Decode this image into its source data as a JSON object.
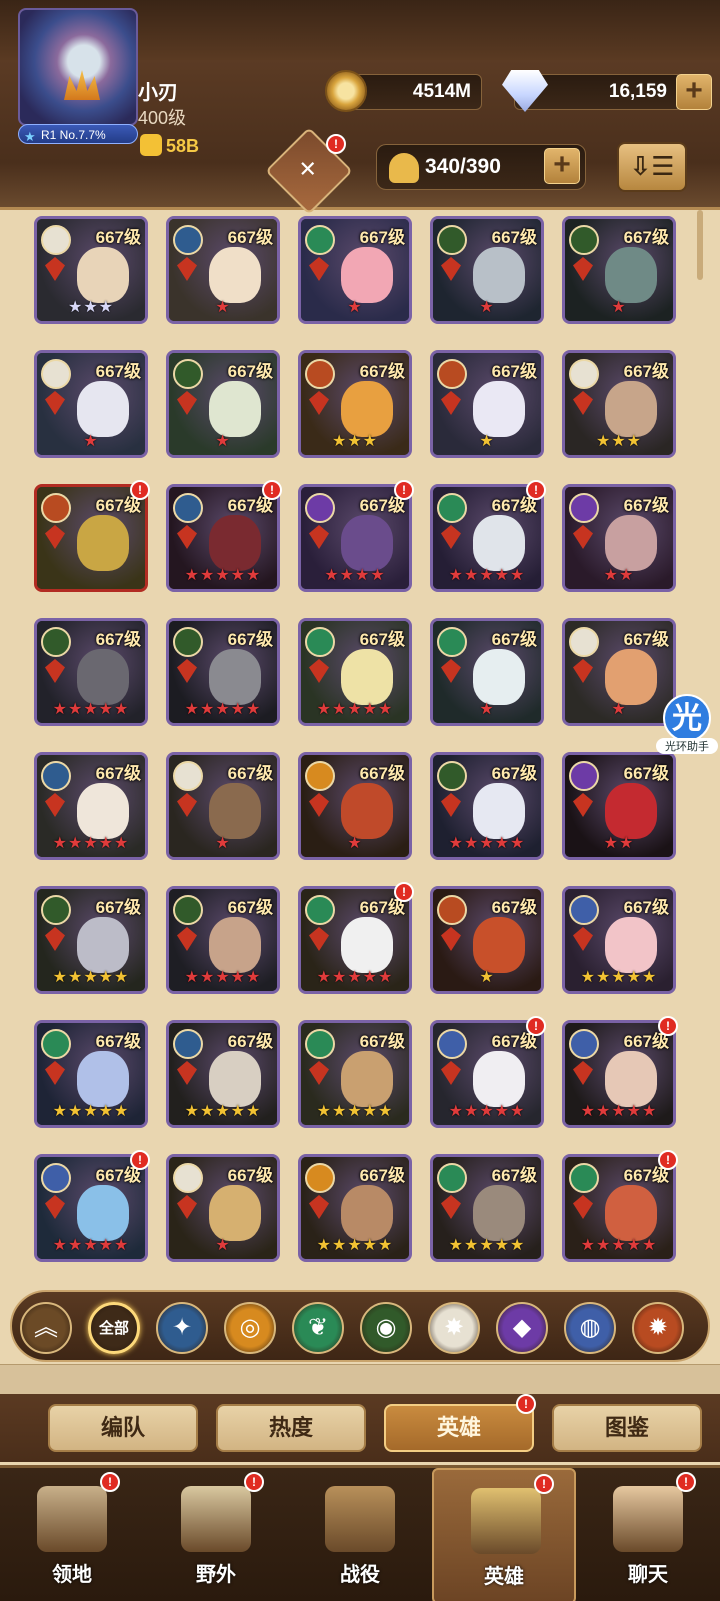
{
  "player": {
    "name": "小刃",
    "level": "400级",
    "power": "58B",
    "rank": "R1 No.7.7%"
  },
  "currencies": {
    "gold": "4514M",
    "gems": "16,159"
  },
  "hero_capacity": "340/390",
  "plus_symbol": "+",
  "sort_symbol": "⇩☰",
  "assistant_label": "光环助手",
  "assistant_glyph": "光",
  "filters": [
    {
      "name": "collapse",
      "glyph": "︽",
      "color": "#6b4a26"
    },
    {
      "name": "all",
      "label": "全部",
      "color": "#3e2a18"
    },
    {
      "name": "lightbearer",
      "glyph": "✦",
      "color": "#2f5c8f"
    },
    {
      "name": "mauler",
      "glyph": "◎",
      "color": "#d78a1f"
    },
    {
      "name": "wilder",
      "glyph": "❦",
      "color": "#2a8a56"
    },
    {
      "name": "graveborn",
      "glyph": "◉",
      "color": "#315a2a"
    },
    {
      "name": "celestial",
      "glyph": "✸",
      "color": "#e7e1d2"
    },
    {
      "name": "hypogean",
      "glyph": "◆",
      "color": "#6d3ba6"
    },
    {
      "name": "dimensional",
      "glyph": "◍",
      "color": "#3f5fa8"
    },
    {
      "name": "other",
      "glyph": "✹",
      "color": "#b84b21"
    }
  ],
  "subtabs": [
    {
      "label": "编队",
      "badge": false
    },
    {
      "label": "热度",
      "badge": false
    },
    {
      "label": "英雄",
      "badge": true,
      "active": true
    },
    {
      "label": "图鉴",
      "badge": false
    }
  ],
  "bottom_nav": [
    {
      "label": "领地",
      "badge": true
    },
    {
      "label": "野外",
      "badge": true
    },
    {
      "label": "战役",
      "badge": false
    },
    {
      "label": "英雄",
      "badge": true,
      "active": true
    },
    {
      "label": "聊天",
      "badge": true
    }
  ],
  "heroes": [
    {
      "level": "667级",
      "stars": "★★★",
      "star_color": "#d8d8f8",
      "faction_color": "#e7e1d2",
      "bg": "#2a2a30",
      "face": "#e8d4b8",
      "badge": false
    },
    {
      "level": "667级",
      "stars": "★",
      "star_color": "#e03b3b",
      "faction_color": "#2f5c8f",
      "bg": "#3a332b",
      "face": "#f0dfc8",
      "badge": false
    },
    {
      "level": "667级",
      "stars": "★",
      "star_color": "#e03b3b",
      "faction_color": "#2a8a56",
      "bg": "#2a2b4a",
      "face": "#f2a7b4",
      "badge": false
    },
    {
      "level": "667级",
      "stars": "★",
      "star_color": "#e03b3b",
      "faction_color": "#315a2a",
      "bg": "#1e2530",
      "face": "#b8c0c8",
      "badge": false
    },
    {
      "level": "667级",
      "stars": "★",
      "star_color": "#e03b3b",
      "faction_color": "#315a2a",
      "bg": "#1c2222",
      "face": "#6f8a86",
      "badge": false
    },
    {
      "level": "667级",
      "stars": "★",
      "star_color": "#e03b3b",
      "faction_color": "#e7e1d2",
      "bg": "#283040",
      "face": "#e6e6f0",
      "badge": false
    },
    {
      "level": "667级",
      "stars": "★",
      "star_color": "#e03b3b",
      "faction_color": "#315a2a",
      "bg": "#2a3a2a",
      "face": "#dfe6d0",
      "badge": false
    },
    {
      "level": "667级",
      "stars": "★★★",
      "star_color": "#f2c233",
      "faction_color": "#b84b21",
      "bg": "#3a2a18",
      "face": "#e8a040",
      "badge": false
    },
    {
      "level": "667级",
      "stars": "★",
      "star_color": "#f2c233",
      "faction_color": "#b84b21",
      "bg": "#2a2a3a",
      "face": "#eae8f4",
      "badge": false
    },
    {
      "level": "667级",
      "stars": "★★★",
      "star_color": "#f2c233",
      "faction_color": "#e7e1d2",
      "bg": "#2a2624",
      "face": "#c7a58a",
      "badge": false
    },
    {
      "level": "667级",
      "stars": "",
      "star_color": "#e03b3b",
      "faction_color": "#b84b21",
      "bg": "#3a3418",
      "face": "#c9a644",
      "badge": true,
      "border": "#b22c22"
    },
    {
      "level": "667级",
      "stars": "★★★★★",
      "star_color": "#e03b3b",
      "faction_color": "#2f5c8f",
      "bg": "#241620",
      "face": "#7a2a30",
      "badge": true
    },
    {
      "level": "667级",
      "stars": "★★★★",
      "star_color": "#e03b3b",
      "faction_color": "#6d3ba6",
      "bg": "#2a1f3a",
      "face": "#6a4c8c",
      "badge": true
    },
    {
      "level": "667级",
      "stars": "★★★★★",
      "star_color": "#e03b3b",
      "faction_color": "#2a8a56",
      "bg": "#251e35",
      "face": "#e0e4ea",
      "badge": true
    },
    {
      "level": "667级",
      "stars": "★★",
      "star_color": "#e03b3b",
      "faction_color": "#6d3ba6",
      "bg": "#2a1a2a",
      "face": "#c8a0a0",
      "badge": false
    },
    {
      "level": "667级",
      "stars": "★★★★★",
      "star_color": "#e03b3b",
      "faction_color": "#315a2a",
      "bg": "#22222a",
      "face": "#6a6870",
      "badge": false
    },
    {
      "level": "667级",
      "stars": "★★★★★",
      "star_color": "#e03b3b",
      "faction_color": "#315a2a",
      "bg": "#1c1c22",
      "face": "#8a8a90",
      "badge": false
    },
    {
      "level": "667级",
      "stars": "★★★★★",
      "star_color": "#e03b3b",
      "faction_color": "#2a8a56",
      "bg": "#2a3424",
      "face": "#eee2a6",
      "badge": false
    },
    {
      "level": "667级",
      "stars": "★",
      "star_color": "#e03b3b",
      "faction_color": "#2a8a56",
      "bg": "#1f2a2a",
      "face": "#e6eef0",
      "badge": false
    },
    {
      "level": "667级",
      "stars": "★",
      "star_color": "#e03b3b",
      "faction_color": "#e7e1d2",
      "bg": "#2c2a26",
      "face": "#e2a070",
      "badge": false
    },
    {
      "level": "667级",
      "stars": "★★★★★",
      "star_color": "#e03b3b",
      "faction_color": "#2f5c8f",
      "bg": "#2a2a26",
      "face": "#efe6da",
      "badge": false
    },
    {
      "level": "667级",
      "stars": "★",
      "star_color": "#e03b3b",
      "faction_color": "#e7e1d2",
      "bg": "#2a2620",
      "face": "#8a6a4e",
      "badge": false
    },
    {
      "level": "667级",
      "stars": "★",
      "star_color": "#e03b3b",
      "faction_color": "#d78a1f",
      "bg": "#2a1e14",
      "face": "#c04a2a",
      "badge": false
    },
    {
      "level": "667级",
      "stars": "★★★★★",
      "star_color": "#e03b3b",
      "faction_color": "#315a2a",
      "bg": "#1e2030",
      "face": "#e6e8f2",
      "badge": false
    },
    {
      "level": "667级",
      "stars": "★★",
      "star_color": "#e03b3b",
      "faction_color": "#6d3ba6",
      "bg": "#1a1216",
      "face": "#c42a30",
      "badge": false
    },
    {
      "level": "667级",
      "stars": "★★★★★",
      "star_color": "#f2c233",
      "faction_color": "#315a2a",
      "bg": "#24261e",
      "face": "#bcbcc8",
      "badge": false
    },
    {
      "level": "667级",
      "stars": "★★★★★",
      "star_color": "#e03b3b",
      "faction_color": "#315a2a",
      "bg": "#1e1e24",
      "face": "#c7a38a",
      "badge": false
    },
    {
      "level": "667级",
      "stars": "★★★★★",
      "star_color": "#e03b3b",
      "faction_color": "#2a8a56",
      "bg": "#2a2418",
      "face": "#f0f0f0",
      "badge": true
    },
    {
      "level": "667级",
      "stars": "★",
      "star_color": "#f2c233",
      "faction_color": "#b84b21",
      "bg": "#2a1a14",
      "face": "#c8502a",
      "badge": false
    },
    {
      "level": "667级",
      "stars": "★★★★★",
      "star_color": "#f2c233",
      "faction_color": "#3f5fa8",
      "bg": "#2a2030",
      "face": "#f2c4c8",
      "badge": false
    },
    {
      "level": "667级",
      "stars": "★★★★★",
      "star_color": "#f2c233",
      "faction_color": "#2a8a56",
      "bg": "#1e2436",
      "face": "#b0c0e8",
      "badge": false
    },
    {
      "level": "667级",
      "stars": "★★★★★",
      "star_color": "#f2c233",
      "faction_color": "#2f5c8f",
      "bg": "#22201e",
      "face": "#d8cfc2",
      "badge": false
    },
    {
      "level": "667级",
      "stars": "★★★★★",
      "star_color": "#f2c233",
      "faction_color": "#2a8a56",
      "bg": "#2a2a1e",
      "face": "#c9a070",
      "badge": false
    },
    {
      "level": "667级",
      "stars": "★★★★★",
      "star_color": "#e03b3b",
      "faction_color": "#3f5fa8",
      "bg": "#26262e",
      "face": "#f0eef2",
      "badge": true
    },
    {
      "level": "667级",
      "stars": "★★★★★",
      "star_color": "#e03b3b",
      "faction_color": "#3f5fa8",
      "bg": "#1e1a1a",
      "face": "#e6c8b6",
      "badge": true
    },
    {
      "level": "667级",
      "stars": "★★★★★",
      "star_color": "#e03b3b",
      "faction_color": "#3f5fa8",
      "bg": "#1e2a3a",
      "face": "#8ac0e8",
      "badge": true
    },
    {
      "level": "667级",
      "stars": "★",
      "star_color": "#e03b3b",
      "faction_color": "#e7e1d2",
      "bg": "#2a2418",
      "face": "#d6b070",
      "badge": false
    },
    {
      "level": "667级",
      "stars": "★★★★★",
      "star_color": "#f2c233",
      "faction_color": "#d78a1f",
      "bg": "#2a2218",
      "face": "#b88a66",
      "badge": false
    },
    {
      "level": "667级",
      "stars": "★★★★★",
      "star_color": "#f2c233",
      "faction_color": "#2a8a56",
      "bg": "#26201c",
      "face": "#9a8a7c",
      "badge": false
    },
    {
      "level": "667级",
      "stars": "★★★★★",
      "star_color": "#e03b3b",
      "faction_color": "#2a8a56",
      "bg": "#2a2018",
      "face": "#d06040",
      "badge": true
    }
  ]
}
